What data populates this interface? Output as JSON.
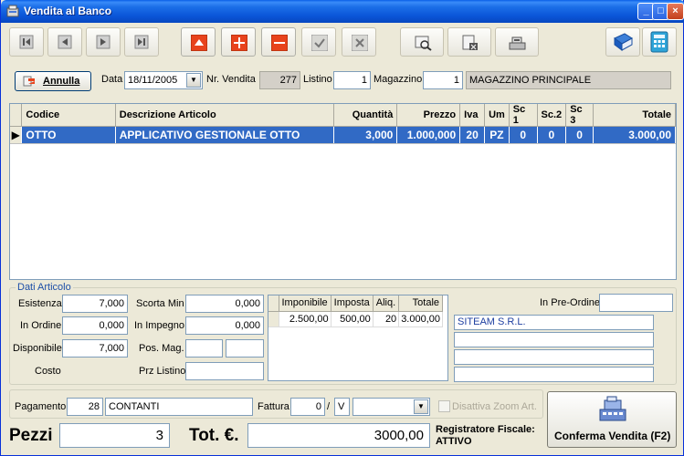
{
  "window": {
    "title": "Vendita al Banco"
  },
  "toolbar": {
    "nav": [
      "first",
      "prev",
      "next",
      "last"
    ],
    "actions": [
      "up",
      "add",
      "remove",
      "confirm",
      "cancel"
    ]
  },
  "header": {
    "cancel_label": "Annulla",
    "date_label": "Data",
    "date_value": "18/11/2005",
    "sale_no_label": "Nr. Vendita",
    "sale_no_value": "277",
    "list_label": "Listino",
    "list_value": "1",
    "warehouse_label": "Magazzino",
    "warehouse_code": "1",
    "warehouse_name": "MAGAZZINO PRINCIPALE"
  },
  "grid": {
    "columns": [
      "Codice",
      "Descrizione Articolo",
      "Quantità",
      "Prezzo",
      "Iva",
      "Um",
      "Sc 1",
      "Sc.2",
      "Sc 3",
      "Totale"
    ],
    "rows": [
      {
        "codice": "OTTO",
        "descrizione": "APPLICATIVO GESTIONALE OTTO",
        "quantita": "3,000",
        "prezzo": "1.000,000",
        "iva": "20",
        "um": "PZ",
        "sc1": "0",
        "sc2": "0",
        "sc3": "0",
        "totale": "3.000,00"
      }
    ]
  },
  "article": {
    "group_title": "Dati Articolo",
    "esistenza_label": "Esistenza",
    "esistenza": "7,000",
    "scorta_min_label": "Scorta Min",
    "scorta_min": "0,000",
    "in_ordine_label": "In Ordine",
    "in_ordine": "0,000",
    "in_impegno_label": "In Impegno",
    "in_impegno": "0,000",
    "disponibile_label": "Disponibile",
    "disponibile": "7,000",
    "pos_mag_label": "Pos. Mag.",
    "costo_label": "Costo",
    "prz_listino_label": "Prz Listino",
    "pre_ordine_label": "In Pre-Ordine",
    "customer": "SITEAM S.R.L."
  },
  "tax_table": {
    "columns": [
      "Imponibile",
      "Imposta",
      "Aliq.",
      "Totale"
    ],
    "rows": [
      {
        "imponibile": "2.500,00",
        "imposta": "500,00",
        "aliq": "20",
        "totale": "3.000,00"
      }
    ]
  },
  "footer": {
    "payment_label": "Pagamento",
    "payment_code": "28",
    "payment_name": "CONTANTI",
    "invoice_label": "Fattura",
    "invoice_no": "0",
    "invoice_sep": "/",
    "invoice_series": "V",
    "zoom_label": "Disattiva Zoom Art.",
    "pieces_label": "Pezzi",
    "pieces_value": "3",
    "total_label": "Tot. €.",
    "total_value": "3000,00",
    "register_label": "Registratore Fiscale:",
    "register_status": "ATTIVO",
    "confirm_label": "Conferma Vendita (F2)"
  }
}
